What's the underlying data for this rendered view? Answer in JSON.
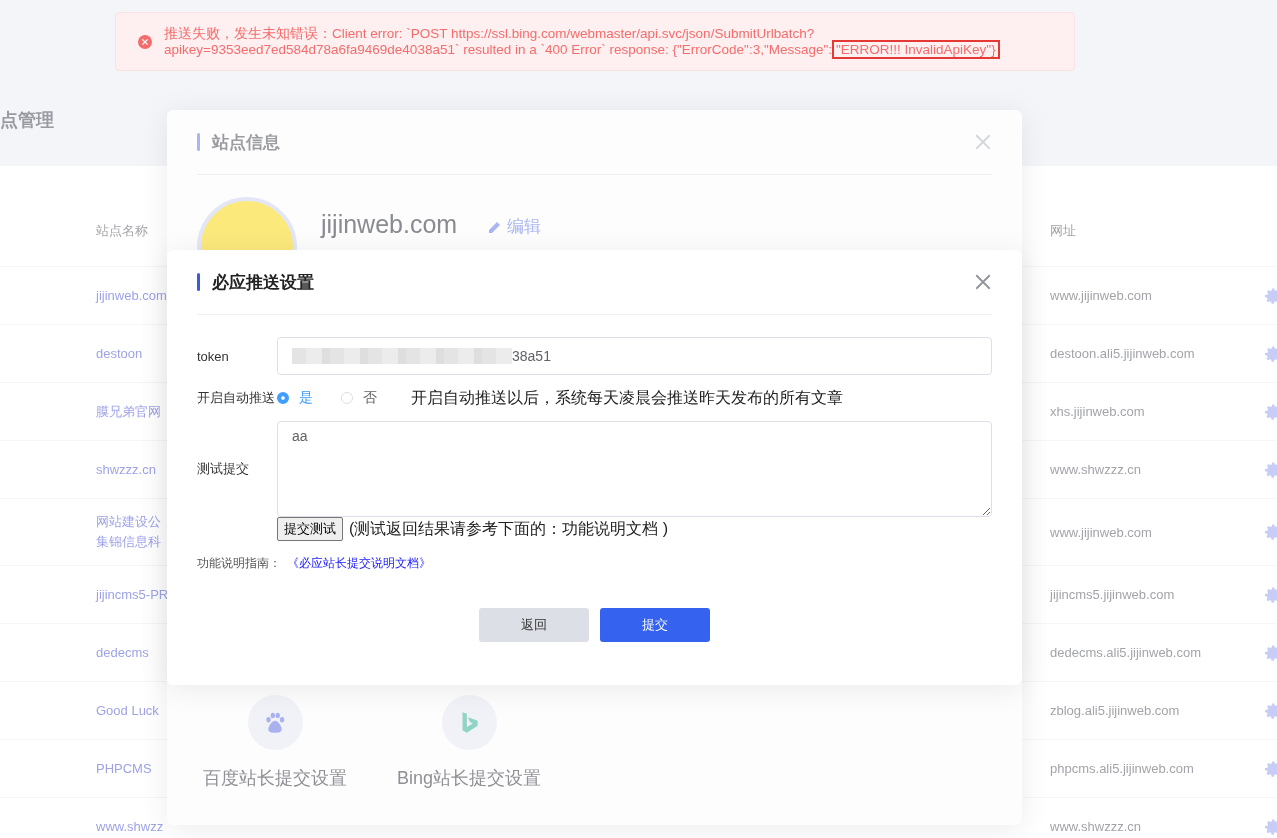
{
  "page": {
    "title": "点管理"
  },
  "table": {
    "columns": [
      "站点名称",
      "网址"
    ],
    "rows": [
      {
        "name": [
          "jijinweb.com"
        ],
        "url": "www.jijinweb.com"
      },
      {
        "name": [
          "destoon"
        ],
        "url": "destoon.ali5.jijinweb.com"
      },
      {
        "name": [
          "膜兄弟官网"
        ],
        "url": "xhs.jijinweb.com"
      },
      {
        "name": [
          "shwzzz.cn"
        ],
        "url": "www.shwzzz.cn"
      },
      {
        "name": [
          "网站建设公",
          "集锦信息科"
        ],
        "url": "www.jijinweb.com"
      },
      {
        "name": [
          "jijincms5-PR"
        ],
        "url": "jijincms5.jijinweb.com"
      },
      {
        "name": [
          "dedecms"
        ],
        "url": "dedecms.ali5.jijinweb.com"
      },
      {
        "name": [
          "Good Luck"
        ],
        "url": "zblog.ali5.jijinweb.com"
      },
      {
        "name": [
          "PHPCMS"
        ],
        "url": "phpcms.ali5.jijinweb.com"
      },
      {
        "name": [
          "www.shwzz"
        ],
        "url": "www.shwzzz.cn"
      }
    ]
  },
  "site_info": {
    "title": "站点信息",
    "domain": "jijinweb.com",
    "edit_label": "编辑",
    "push_options": [
      {
        "label": "百度站长提交设置",
        "kind": "baidu"
      },
      {
        "label": "Bing站长提交设置",
        "kind": "bing"
      }
    ]
  },
  "bing_dialog": {
    "title": "必应推送设置",
    "token": {
      "label": "token",
      "value": "38a51"
    },
    "auto_push": {
      "label": "开启自动推送",
      "options": [
        {
          "label": "是",
          "selected": true
        },
        {
          "label": "否",
          "selected": false
        }
      ],
      "hint": "开启自动推送以后，系统每天凌晨会推送昨天发布的所有文章"
    },
    "test": {
      "label": "测试提交",
      "value": "aa",
      "button": "提交测试",
      "note": "(测试返回结果请参考下面的：功能说明文档 )"
    },
    "guide": {
      "label": "功能说明指南：",
      "link": "《必应站长提交说明文档》"
    },
    "buttons": [
      {
        "label": "返回",
        "kind": "secondary"
      },
      {
        "label": "提交",
        "kind": "primary"
      }
    ]
  },
  "toast": {
    "message": "推送失败，发生未知错误：Client error: `POST https://ssl.bing.com/webmaster/api.svc/json/SubmitUrlbatch?\napikey=9353eed7ed584d78a6fa9469de4038a51` resulted in a `400 Error` response: {\"ErrorCode\":3,\"Message\":",
    "highlight": "\"ERROR!!! InvalidApiKey\"}"
  }
}
